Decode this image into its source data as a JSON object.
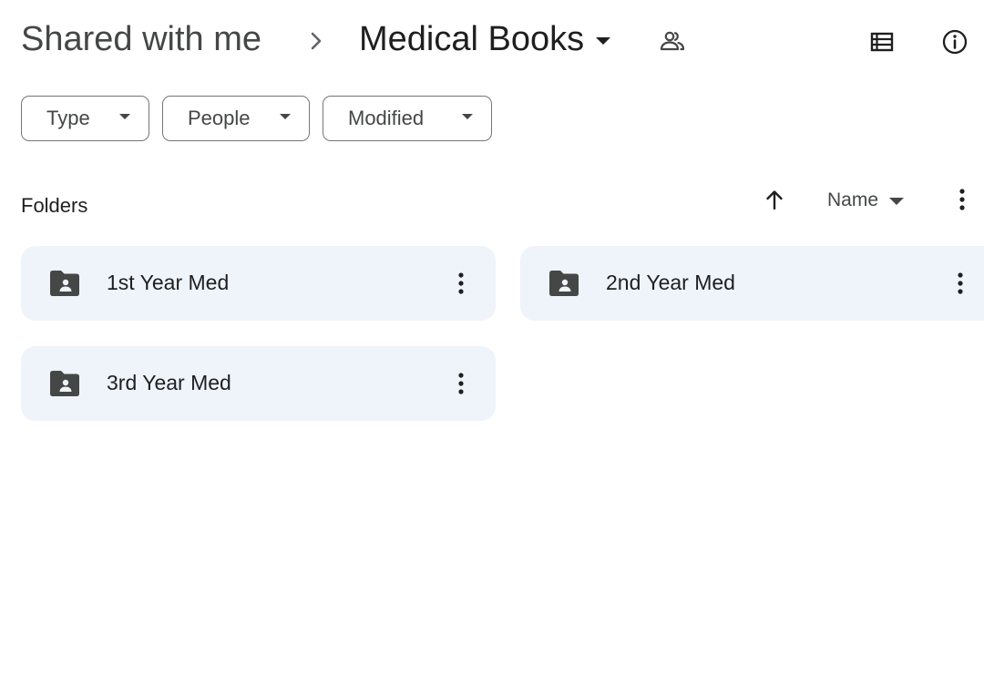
{
  "breadcrumb": {
    "root": "Shared with me",
    "current": "Medical Books"
  },
  "filters": [
    {
      "label": "Type"
    },
    {
      "label": "People"
    },
    {
      "label": "Modified"
    }
  ],
  "section": {
    "label": "Folders",
    "sort_field": "Name",
    "sort_direction": "ascending"
  },
  "folders": [
    {
      "name": "1st Year Med"
    },
    {
      "name": "2nd Year Med"
    },
    {
      "name": "3rd Year Med"
    }
  ],
  "icons": {
    "breadcrumb_separator": "chevron-right-icon",
    "shared": "people-icon",
    "view": "list-view-icon",
    "info": "info-icon",
    "folder": "shared-folder-icon",
    "more": "more-vert-icon"
  },
  "colors": {
    "card_background": "#eff3fa",
    "icon_gray": "#444746",
    "text": "#1f1f1f"
  }
}
